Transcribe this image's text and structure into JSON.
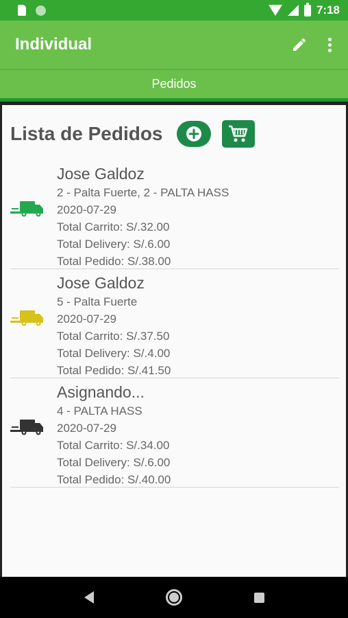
{
  "status_bar": {
    "time": "7:18"
  },
  "app_bar": {
    "title": "Individual",
    "edit_icon": "pencil-icon",
    "menu_icon": "more-vert-icon"
  },
  "tabs": [
    {
      "label": "Pedidos"
    }
  ],
  "list": {
    "title": "Lista de Pedidos",
    "add_icon": "add-circle-icon",
    "cart_icon": "cart-icon"
  },
  "orders": [
    {
      "name": "Jose Galdoz",
      "items": "2 - Palta Fuerte, 2 - PALTA HASS",
      "date": "2020-07-29",
      "total_carrito": "Total Carrito: S/.32.00",
      "total_delivery": "Total Delivery: S/.6.00",
      "total_pedido": "Total Pedido: S/.38.00",
      "truck_color": "#23a84f"
    },
    {
      "name": "Jose Galdoz",
      "items": "5 - Palta Fuerte",
      "date": "2020-07-29",
      "total_carrito": "Total Carrito: S/.37.50",
      "total_delivery": "Total Delivery: S/.4.00",
      "total_pedido": "Total Pedido: S/.41.50",
      "truck_color": "#d6c21a"
    },
    {
      "name": "Asignando...",
      "items": "4 - PALTA HASS",
      "date": "2020-07-29",
      "total_carrito": "Total Carrito: S/.34.00",
      "total_delivery": "Total Delivery: S/.6.00",
      "total_pedido": "Total Pedido: S/.40.00",
      "truck_color": "#333333"
    }
  ],
  "colors": {
    "primary": "#6bc04b",
    "status_bar": "#35a832",
    "accent": "#1d8a4a"
  }
}
